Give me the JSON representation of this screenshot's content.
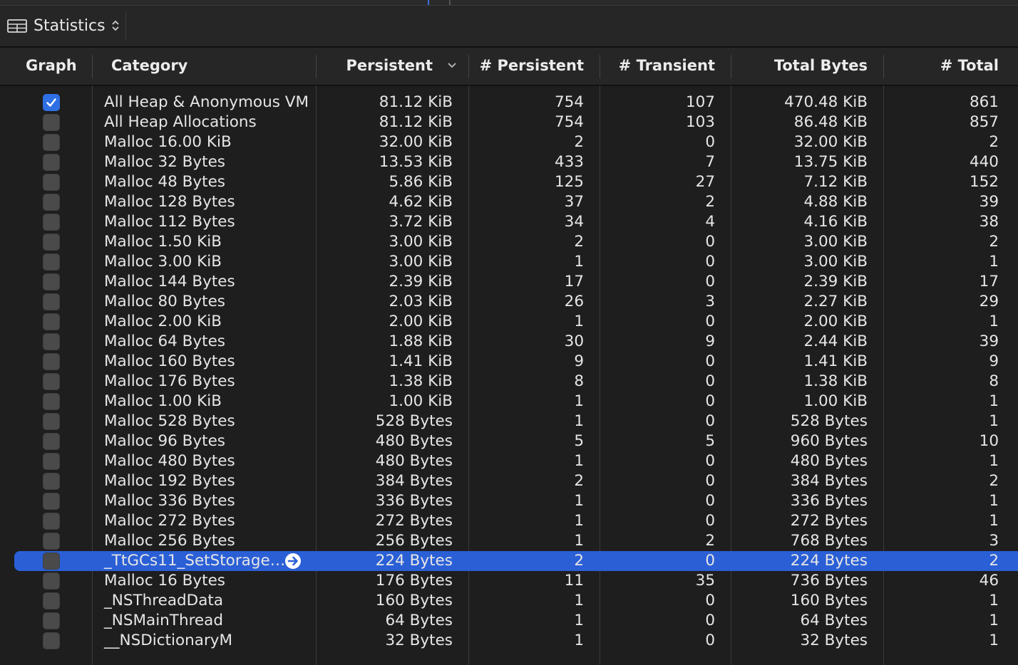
{
  "toolbar": {
    "view_label": "Statistics",
    "view_icon": "grid-icon",
    "chooser_icon": "up-down-chevron-icon"
  },
  "columns": {
    "graph": "Graph",
    "category": "Category",
    "persistent": "Persistent",
    "n_persistent": "# Persistent",
    "n_transient": "# Transient",
    "total_bytes": "Total Bytes",
    "n_total": "# Total"
  },
  "sort": {
    "column": "Persistent",
    "direction": "descending",
    "icon": "chevron-down-icon"
  },
  "colors": {
    "selection": "#2a5fd6",
    "checkbox_on": "#2f6fe4",
    "background": "#1e1e1e"
  },
  "rows": [
    {
      "checked": true,
      "category": "All Heap & Anonymous VM",
      "persistent": "81.12 KiB",
      "n_persistent": "754",
      "n_transient": "107",
      "total_bytes": "470.48 KiB",
      "n_total": "861"
    },
    {
      "checked": false,
      "category": "All Heap Allocations",
      "persistent": "81.12 KiB",
      "n_persistent": "754",
      "n_transient": "103",
      "total_bytes": "86.48 KiB",
      "n_total": "857"
    },
    {
      "checked": false,
      "category": "Malloc 16.00 KiB",
      "persistent": "32.00 KiB",
      "n_persistent": "2",
      "n_transient": "0",
      "total_bytes": "32.00 KiB",
      "n_total": "2"
    },
    {
      "checked": false,
      "category": "Malloc 32 Bytes",
      "persistent": "13.53 KiB",
      "n_persistent": "433",
      "n_transient": "7",
      "total_bytes": "13.75 KiB",
      "n_total": "440"
    },
    {
      "checked": false,
      "category": "Malloc 48 Bytes",
      "persistent": "5.86 KiB",
      "n_persistent": "125",
      "n_transient": "27",
      "total_bytes": "7.12 KiB",
      "n_total": "152"
    },
    {
      "checked": false,
      "category": "Malloc 128 Bytes",
      "persistent": "4.62 KiB",
      "n_persistent": "37",
      "n_transient": "2",
      "total_bytes": "4.88 KiB",
      "n_total": "39"
    },
    {
      "checked": false,
      "category": "Malloc 112 Bytes",
      "persistent": "3.72 KiB",
      "n_persistent": "34",
      "n_transient": "4",
      "total_bytes": "4.16 KiB",
      "n_total": "38"
    },
    {
      "checked": false,
      "category": "Malloc 1.50 KiB",
      "persistent": "3.00 KiB",
      "n_persistent": "2",
      "n_transient": "0",
      "total_bytes": "3.00 KiB",
      "n_total": "2"
    },
    {
      "checked": false,
      "category": "Malloc 3.00 KiB",
      "persistent": "3.00 KiB",
      "n_persistent": "1",
      "n_transient": "0",
      "total_bytes": "3.00 KiB",
      "n_total": "1"
    },
    {
      "checked": false,
      "category": "Malloc 144 Bytes",
      "persistent": "2.39 KiB",
      "n_persistent": "17",
      "n_transient": "0",
      "total_bytes": "2.39 KiB",
      "n_total": "17"
    },
    {
      "checked": false,
      "category": "Malloc 80 Bytes",
      "persistent": "2.03 KiB",
      "n_persistent": "26",
      "n_transient": "3",
      "total_bytes": "2.27 KiB",
      "n_total": "29"
    },
    {
      "checked": false,
      "category": "Malloc 2.00 KiB",
      "persistent": "2.00 KiB",
      "n_persistent": "1",
      "n_transient": "0",
      "total_bytes": "2.00 KiB",
      "n_total": "1"
    },
    {
      "checked": false,
      "category": "Malloc 64 Bytes",
      "persistent": "1.88 KiB",
      "n_persistent": "30",
      "n_transient": "9",
      "total_bytes": "2.44 KiB",
      "n_total": "39"
    },
    {
      "checked": false,
      "category": "Malloc 160 Bytes",
      "persistent": "1.41 KiB",
      "n_persistent": "9",
      "n_transient": "0",
      "total_bytes": "1.41 KiB",
      "n_total": "9"
    },
    {
      "checked": false,
      "category": "Malloc 176 Bytes",
      "persistent": "1.38 KiB",
      "n_persistent": "8",
      "n_transient": "0",
      "total_bytes": "1.38 KiB",
      "n_total": "8"
    },
    {
      "checked": false,
      "category": "Malloc 1.00 KiB",
      "persistent": "1.00 KiB",
      "n_persistent": "1",
      "n_transient": "0",
      "total_bytes": "1.00 KiB",
      "n_total": "1"
    },
    {
      "checked": false,
      "category": "Malloc 528 Bytes",
      "persistent": "528 Bytes",
      "n_persistent": "1",
      "n_transient": "0",
      "total_bytes": "528 Bytes",
      "n_total": "1"
    },
    {
      "checked": false,
      "category": "Malloc 96 Bytes",
      "persistent": "480 Bytes",
      "n_persistent": "5",
      "n_transient": "5",
      "total_bytes": "960 Bytes",
      "n_total": "10"
    },
    {
      "checked": false,
      "category": "Malloc 480 Bytes",
      "persistent": "480 Bytes",
      "n_persistent": "1",
      "n_transient": "0",
      "total_bytes": "480 Bytes",
      "n_total": "1"
    },
    {
      "checked": false,
      "category": "Malloc 192 Bytes",
      "persistent": "384 Bytes",
      "n_persistent": "2",
      "n_transient": "0",
      "total_bytes": "384 Bytes",
      "n_total": "2"
    },
    {
      "checked": false,
      "category": "Malloc 336 Bytes",
      "persistent": "336 Bytes",
      "n_persistent": "1",
      "n_transient": "0",
      "total_bytes": "336 Bytes",
      "n_total": "1"
    },
    {
      "checked": false,
      "category": "Malloc 272 Bytes",
      "persistent": "272 Bytes",
      "n_persistent": "1",
      "n_transient": "0",
      "total_bytes": "272 Bytes",
      "n_total": "1"
    },
    {
      "checked": false,
      "category": "Malloc 256 Bytes",
      "persistent": "256 Bytes",
      "n_persistent": "1",
      "n_transient": "2",
      "total_bytes": "768 Bytes",
      "n_total": "3"
    },
    {
      "checked": false,
      "selected": true,
      "focus_icon": "arrow-right-circle-icon",
      "category": "_TtGCs11_SetStorage…",
      "persistent": "224 Bytes",
      "n_persistent": "2",
      "n_transient": "0",
      "total_bytes": "224 Bytes",
      "n_total": "2"
    },
    {
      "checked": false,
      "category": "Malloc 16 Bytes",
      "persistent": "176 Bytes",
      "n_persistent": "11",
      "n_transient": "35",
      "total_bytes": "736 Bytes",
      "n_total": "46"
    },
    {
      "checked": false,
      "category": "_NSThreadData",
      "persistent": "160 Bytes",
      "n_persistent": "1",
      "n_transient": "0",
      "total_bytes": "160 Bytes",
      "n_total": "1"
    },
    {
      "checked": false,
      "category": "_NSMainThread",
      "persistent": "64 Bytes",
      "n_persistent": "1",
      "n_transient": "0",
      "total_bytes": "64 Bytes",
      "n_total": "1"
    },
    {
      "checked": false,
      "category": "__NSDictionaryM",
      "persistent": "32 Bytes",
      "n_persistent": "1",
      "n_transient": "0",
      "total_bytes": "32 Bytes",
      "n_total": "1"
    }
  ]
}
